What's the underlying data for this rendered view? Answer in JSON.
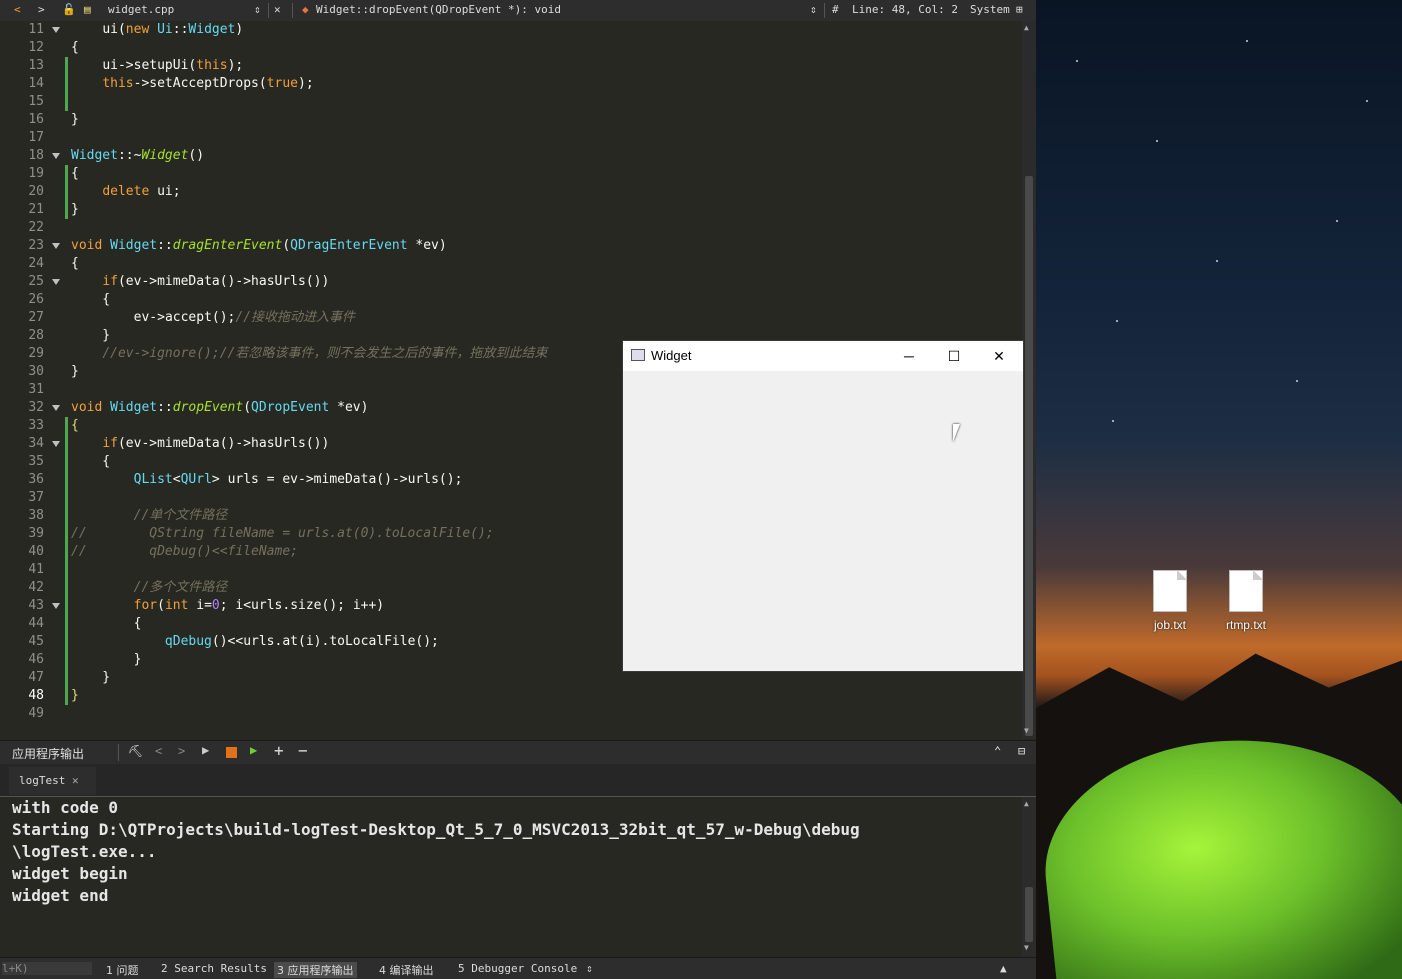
{
  "toolbar": {
    "file_name": "widget.cpp",
    "function_sig": "Widget::dropEvent(QDropEvent *): void",
    "hash": "#",
    "position": "Line: 48, Col: 2",
    "encoding": "System"
  },
  "code_lines": [
    {
      "n": "11",
      "html": "    <span class='nm'>ui</span>(<span class='kw'>new</span> <span class='ty'>Ui</span>::<span class='ty'>Widget</span>)"
    },
    {
      "n": "12",
      "html": "{"
    },
    {
      "n": "13",
      "html": "    <span class='nm'>ui</span>-><span class='nm'>setupUi</span>(<span class='kw'>this</span>);"
    },
    {
      "n": "14",
      "html": "    <span class='kw'>this</span>-><span class='nm'>setAcceptDrops</span>(<span class='kw'>true</span>);"
    },
    {
      "n": "15",
      "html": ""
    },
    {
      "n": "16",
      "html": "}"
    },
    {
      "n": "17",
      "html": ""
    },
    {
      "n": "18",
      "html": "<span class='ty'>Widget</span>::~<span class='fn'>Widget</span>()"
    },
    {
      "n": "19",
      "html": "{"
    },
    {
      "n": "20",
      "html": "    <span class='kw'>delete</span> <span class='nm'>ui</span>;"
    },
    {
      "n": "21",
      "html": "}"
    },
    {
      "n": "22",
      "html": ""
    },
    {
      "n": "23",
      "html": "<span class='kw'>void</span> <span class='ty'>Widget</span>::<span class='fn'>dragEnterEvent</span>(<span class='ty'>QDragEnterEvent</span> *<span class='nm'>ev</span>)"
    },
    {
      "n": "24",
      "html": "{"
    },
    {
      "n": "25",
      "html": "    <span class='kw'>if</span>(<span class='nm'>ev</span>-><span class='nm'>mimeData</span>()-><span class='nm'>hasUrls</span>())"
    },
    {
      "n": "26",
      "html": "    {"
    },
    {
      "n": "27",
      "html": "        <span class='nm'>ev</span>-><span class='nm'>accept</span>();<span class='cm'>//接收拖动进入事件</span>"
    },
    {
      "n": "28",
      "html": "    }"
    },
    {
      "n": "29",
      "html": "    <span class='cm'>//ev->ignore();//若忽略该事件，则不会发生之后的事件，拖放到此结束</span>"
    },
    {
      "n": "30",
      "html": "}"
    },
    {
      "n": "31",
      "html": ""
    },
    {
      "n": "32",
      "html": "<span class='kw'>void</span> <span class='ty'>Widget</span>::<span class='fn'>dropEvent</span>(<span class='ty'>QDropEvent</span> *<span class='nm'>ev</span>)"
    },
    {
      "n": "33",
      "html": "<span class='mac'>{</span>"
    },
    {
      "n": "34",
      "html": "    <span class='kw'>if</span>(<span class='nm'>ev</span>-><span class='nm'>mimeData</span>()-><span class='nm'>hasUrls</span>())"
    },
    {
      "n": "35",
      "html": "    {"
    },
    {
      "n": "36",
      "html": "        <span class='ty'>QList</span>&lt;<span class='ty'>QUrl</span>&gt; <span class='nm'>urls</span> = <span class='nm'>ev</span>-><span class='nm'>mimeData</span>()-><span class='nm'>urls</span>();"
    },
    {
      "n": "37",
      "html": ""
    },
    {
      "n": "38",
      "html": "        <span class='cm'>//单个文件路径</span>"
    },
    {
      "n": "39",
      "html": "<span class='cm'>//        QString fileName = urls.at(0).toLocalFile();</span>"
    },
    {
      "n": "40",
      "html": "<span class='cm'>//        qDebug()&lt;&lt;fileName;</span>"
    },
    {
      "n": "41",
      "html": ""
    },
    {
      "n": "42",
      "html": "        <span class='cm'>//多个文件路径</span>"
    },
    {
      "n": "43",
      "html": "        <span class='kw'>for</span>(<span class='kw'>int</span> <span class='nm'>i</span>=<span class='num'>0</span>; <span class='nm'>i</span>&lt;<span class='nm'>urls</span>.<span class='nm'>size</span>(); <span class='nm'>i</span>++)"
    },
    {
      "n": "44",
      "html": "        {"
    },
    {
      "n": "45",
      "html": "            <span class='ty'>qDebug</span>()&lt;&lt;<span class='nm'>urls</span>.<span class='nm'>at</span>(<span class='nm'>i</span>).<span class='nm'>toLocalFile</span>();"
    },
    {
      "n": "46",
      "html": "        }"
    },
    {
      "n": "47",
      "html": "    }"
    },
    {
      "n": "48",
      "html": "<span class='mac'>}</span>"
    },
    {
      "n": "49",
      "html": ""
    }
  ],
  "output_panel": {
    "title": "应用程序输出",
    "tab": "logTest",
    "lines": [
      "with code 0",
      "",
      "Starting D:\\QTProjects\\build-logTest-Desktop_Qt_5_7_0_MSVC2013_32bit_qt_57_w-Debug\\debug",
      "\\logTest.exe...",
      "widget begin",
      "widget end"
    ]
  },
  "statusbar": {
    "left": "l+K)",
    "items": [
      "1 问题",
      "2 Search Results",
      "3 应用程序输出",
      "4 编译输出",
      "5 Debugger Console"
    ]
  },
  "widget_window": {
    "title": "Widget"
  },
  "desktop_files": [
    "job.txt",
    "rtmp.txt"
  ]
}
